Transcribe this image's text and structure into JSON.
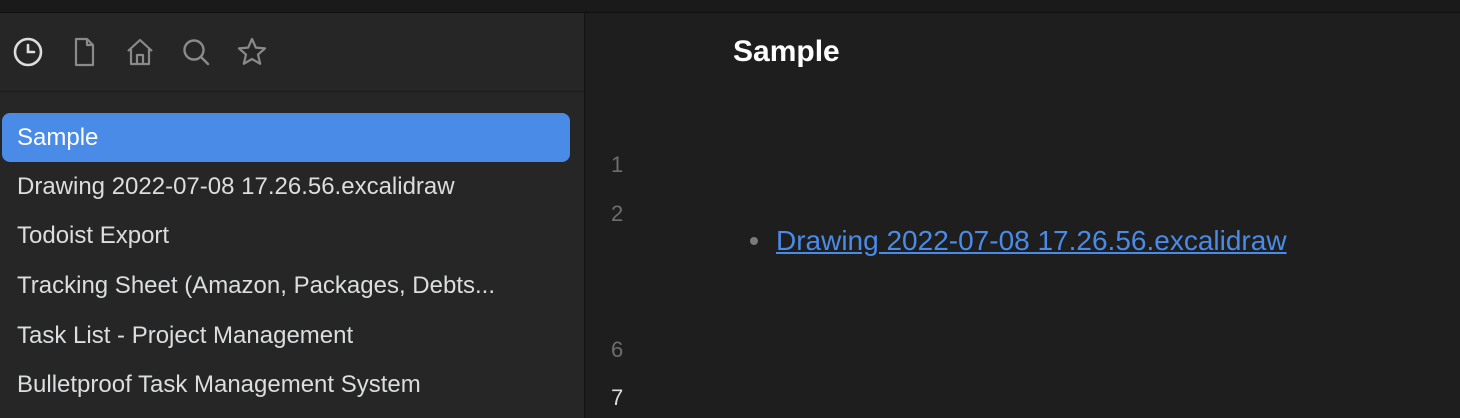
{
  "sidebar": {
    "tabs": [
      {
        "name": "recent-files-icon"
      },
      {
        "name": "file-icon"
      },
      {
        "name": "home-icon"
      },
      {
        "name": "search-icon"
      },
      {
        "name": "star-icon"
      }
    ],
    "files": [
      {
        "label": "Sample",
        "active": true
      },
      {
        "label": "Drawing 2022-07-08 17.26.56.excalidraw",
        "active": false
      },
      {
        "label": "Todoist Export",
        "active": false
      },
      {
        "label": "Tracking Sheet (Amazon, Packages, Debts...",
        "active": false
      },
      {
        "label": "Task List - Project Management",
        "active": false
      },
      {
        "label": "Bulletproof Task Management System",
        "active": false
      }
    ]
  },
  "editor": {
    "title": "Sample",
    "line_numbers": [
      "1",
      "2",
      "6",
      "7"
    ],
    "embedded_link": "Drawing 2022-07-08 17.26.56.excalidraw"
  },
  "colors": {
    "accent": "#4a8be8",
    "sidebar_bg": "#262626",
    "editor_bg": "#1e1e1e"
  }
}
